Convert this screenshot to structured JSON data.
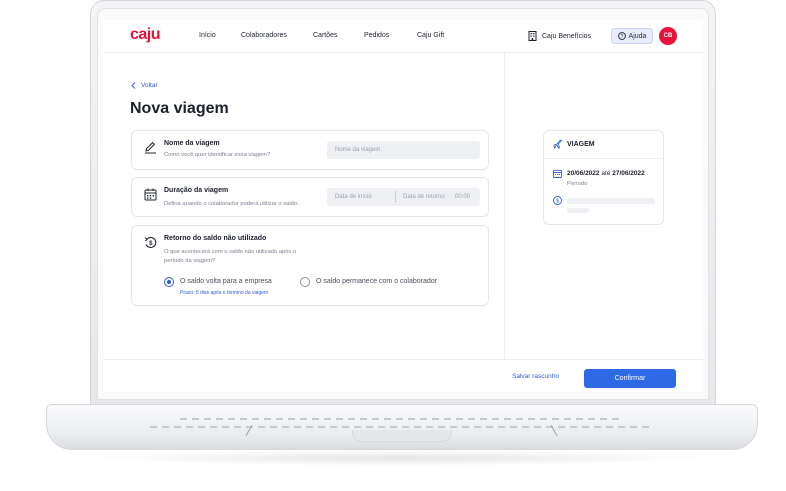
{
  "header": {
    "logo": "caju",
    "nav": [
      "Início",
      "Colaboradores",
      "Cartões",
      "Pedidos",
      "Caju Gift"
    ],
    "company": "Caju Benefícios",
    "help": "Ajuda",
    "avatar_initials": "CB"
  },
  "page": {
    "back_label": "Voltar",
    "title": "Nova viagem"
  },
  "trip_name": {
    "title": "Nome da viagem",
    "subtitle": "Como você quer identificar essa viagem?",
    "placeholder": "Nome da viagem"
  },
  "duration": {
    "title": "Duração da viagem",
    "subtitle": "Defina quando o colaborador poderá utilizar o saldo.",
    "start_placeholder": "Data de início",
    "end_placeholder": "Data de retorno",
    "time": "00:00"
  },
  "balance_return": {
    "title": "Retorno do saldo não utilizado",
    "subtitle_line1": "O que acontecerá com o saldo não utilizado após o",
    "subtitle_line2": "período da viagem?",
    "option_company": "O saldo volta para a empresa",
    "option_company_hint": "Prazo: 5 dias após o término da viagem",
    "option_employee": "O saldo permanece com o colaborador",
    "selected": "company"
  },
  "summary": {
    "title": "VIAGEM",
    "start_date": "20/06/2022",
    "connector": "até",
    "end_date": "27/06/2022",
    "period_label": "Período"
  },
  "footer": {
    "save_draft": "Salvar rascunho",
    "confirm": "Confirmar"
  },
  "colors": {
    "brand": "#e8113a",
    "primary": "#2f6ae6",
    "link": "#2f5bd6"
  }
}
